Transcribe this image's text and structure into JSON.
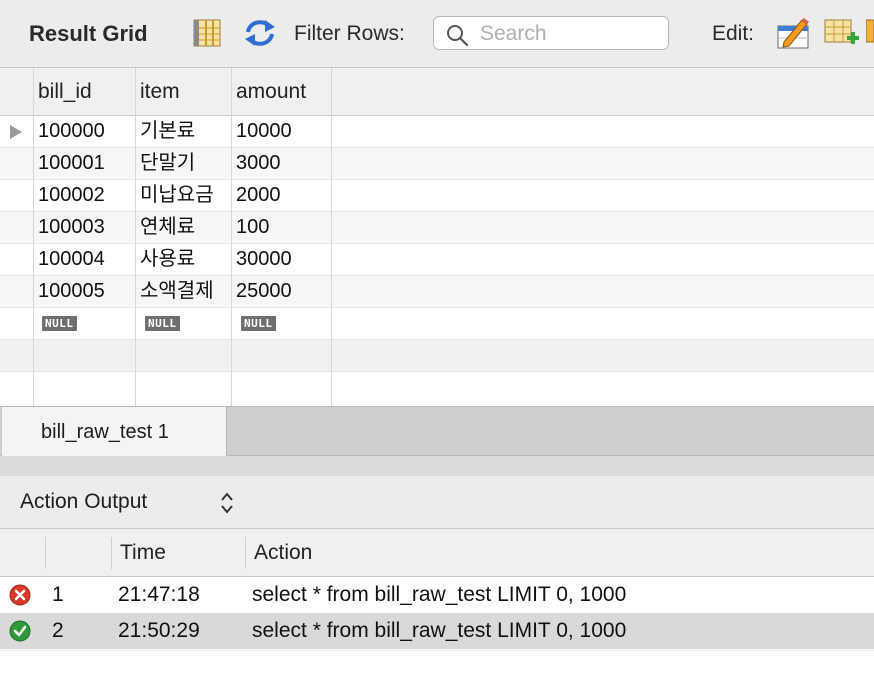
{
  "toolbar": {
    "title": "Result Grid",
    "filter_label": "Filter Rows:",
    "search_placeholder": "Search",
    "edit_label": "Edit:"
  },
  "grid": {
    "columns": [
      "bill_id",
      "item",
      "amount"
    ],
    "rows": [
      [
        "100000",
        "기본료",
        "10000"
      ],
      [
        "100001",
        "단말기",
        "3000"
      ],
      [
        "100002",
        "미납요금",
        "2000"
      ],
      [
        "100003",
        "연체료",
        "100"
      ],
      [
        "100004",
        "사용료",
        "30000"
      ],
      [
        "100005",
        "소액결제",
        "25000"
      ]
    ],
    "null_label": "NULL"
  },
  "result_tab": {
    "label": "bill_raw_test 1"
  },
  "output": {
    "selector_label": "Action Output",
    "columns": [
      "",
      "",
      "Time",
      "Action"
    ],
    "rows": [
      {
        "status": "error",
        "index": "1",
        "time": "21:47:18",
        "action": "select * from bill_raw_test LIMIT 0, 1000"
      },
      {
        "status": "success",
        "index": "2",
        "time": "21:50:29",
        "action": "select * from bill_raw_test LIMIT 0, 1000"
      }
    ]
  },
  "colors": {
    "accent_blue": "#2f6fd1",
    "error_red": "#d83a2a",
    "success_green": "#2e9a3a",
    "toolbar_bg": "#ececec"
  }
}
